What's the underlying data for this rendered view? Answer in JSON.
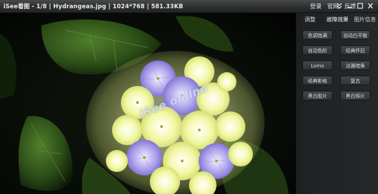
{
  "titlebar": {
    "app_name": "iSee看图",
    "position": "1/8",
    "file_name": "Hydrangeas.jpg",
    "dimensions": "1024*768",
    "file_size": "581.33KB",
    "menu": [
      "登录",
      "官网",
      "反馈"
    ]
  },
  "watermark": "iSee online",
  "panel": {
    "tabs": [
      "调整",
      "故障效果",
      "图片信息"
    ],
    "effects": [
      "色调饱满",
      "自动白平衡",
      "自动色阶",
      "经典怀旧",
      "Lomo",
      "淡雅暗角",
      "经典影格",
      "复古",
      "黑白胶片",
      "黑白照片"
    ]
  },
  "icons": {
    "more": "chevron-double-down-icon",
    "minimize": "minimize-icon",
    "maximize": "maximize-icon",
    "close": "close-icon"
  }
}
